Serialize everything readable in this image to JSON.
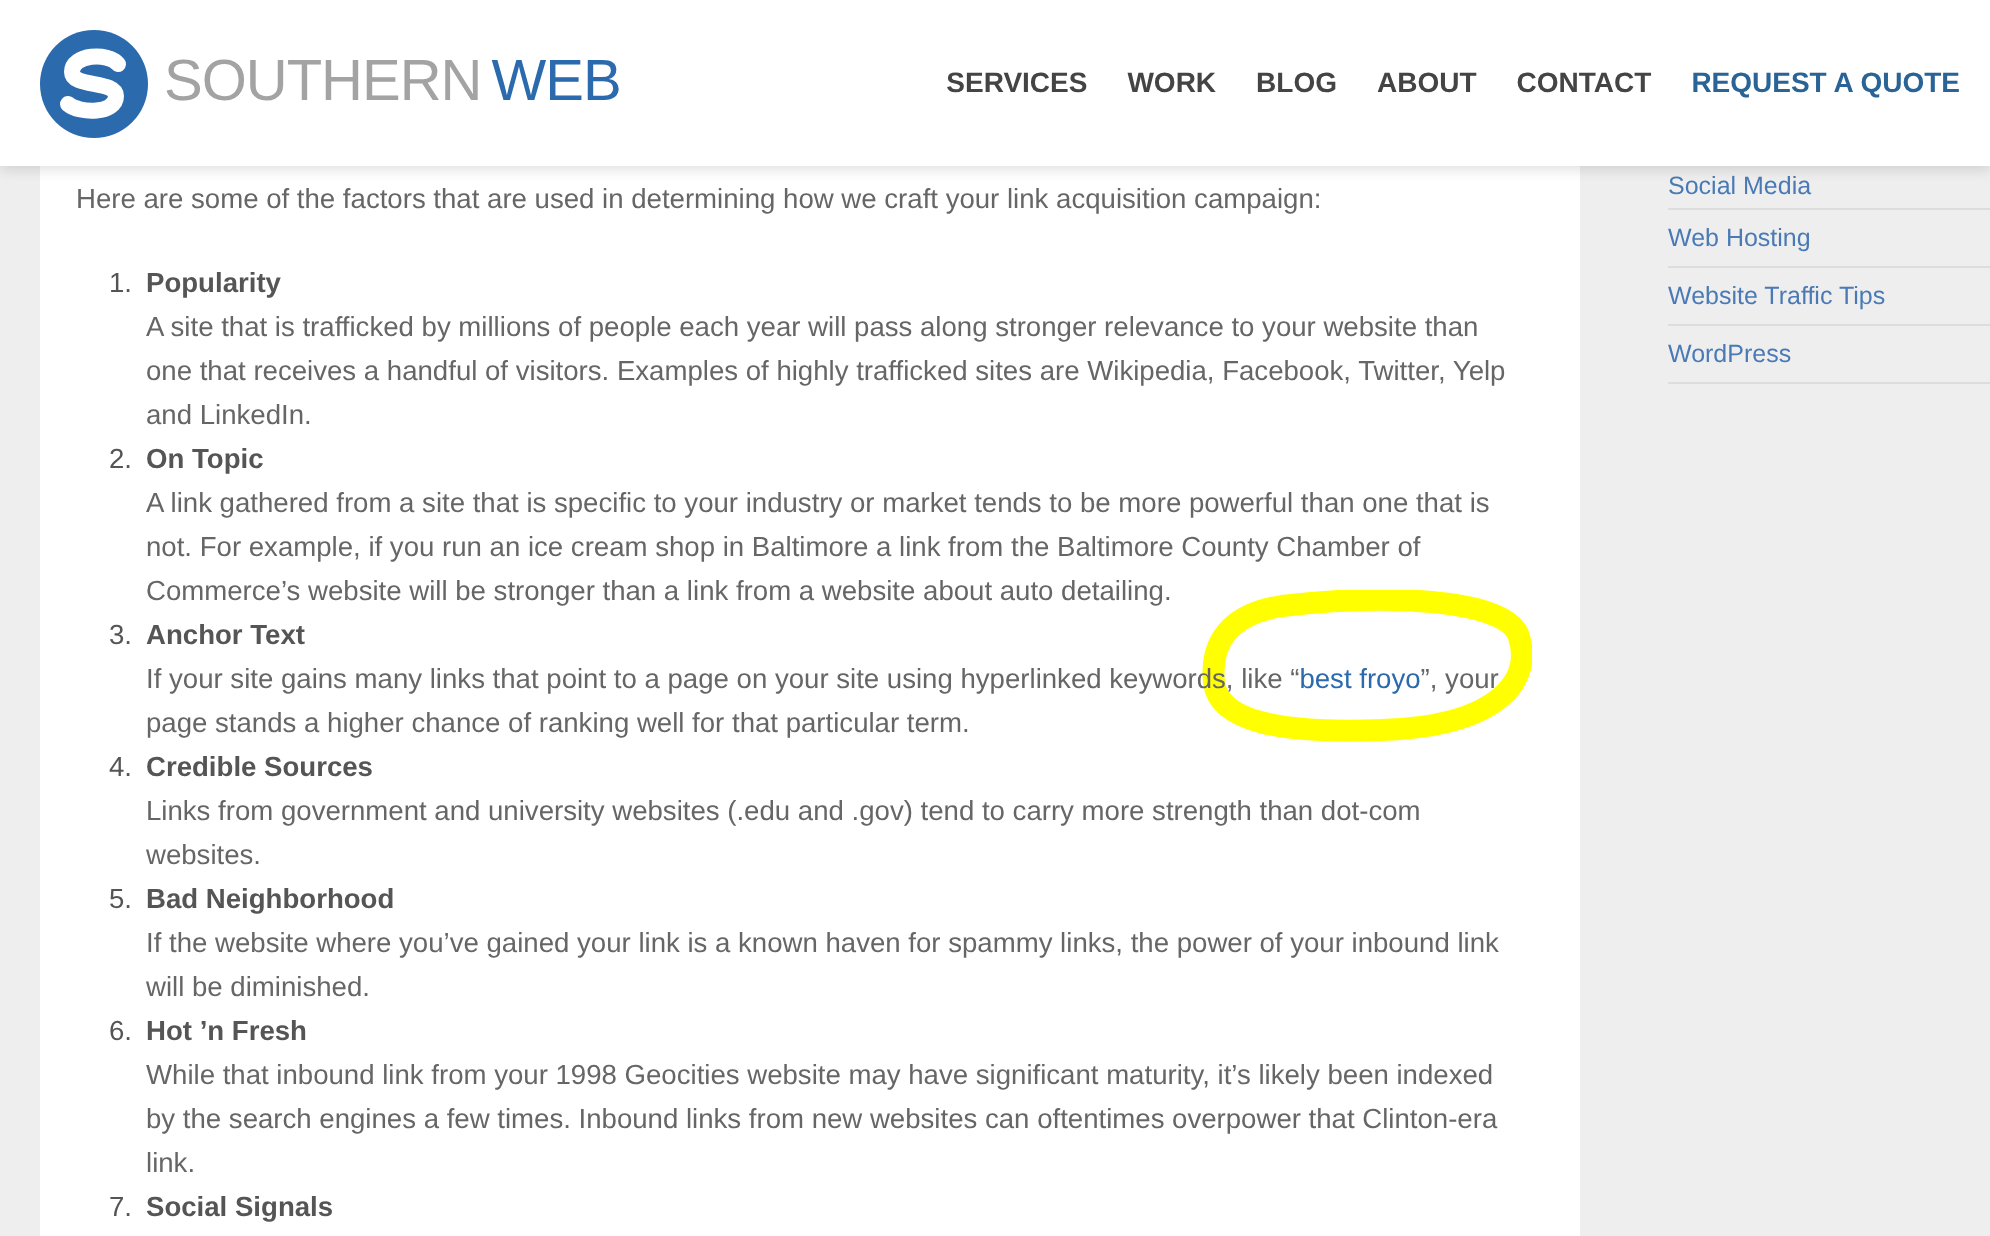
{
  "header": {
    "logo": {
      "word_1": "SOUTHERN",
      "word_2": "WEB"
    },
    "nav": [
      {
        "label": "SERVICES",
        "highlighted": false
      },
      {
        "label": "WORK",
        "highlighted": false
      },
      {
        "label": "BLOG",
        "highlighted": false
      },
      {
        "label": "ABOUT",
        "highlighted": false
      },
      {
        "label": "CONTACT",
        "highlighted": false
      },
      {
        "label": "REQUEST A QUOTE",
        "highlighted": true
      }
    ]
  },
  "intro": "Here are some of the factors that are used in determining how we craft your link acquisition campaign:",
  "factors": [
    {
      "number": "1.",
      "title": "Popularity",
      "description": [
        {
          "kind": "text",
          "text": "A site that is trafficked by millions of people each year will pass along stronger relevance to your website than one that receives a handful of visitors. Examples of highly trafficked sites are Wikipedia, Facebook, Twitter, Yelp and LinkedIn."
        }
      ]
    },
    {
      "number": "2.",
      "title": "On Topic",
      "description": [
        {
          "kind": "text",
          "text": "A link gathered from a site that is specific to your industry or market tends to be more powerful than one that is not. For example, if you run an ice cream shop in Baltimore a link from the Baltimore County Chamber of Commerce’s website will be stronger than a link from a website about auto detailing."
        }
      ]
    },
    {
      "number": "3.",
      "title": "Anchor Text",
      "description": [
        {
          "kind": "text",
          "text": "If your site gains many links that point to a page on your site using hyperlinked keywords, like “"
        },
        {
          "kind": "link",
          "text": "best froyo",
          "circled": true
        },
        {
          "kind": "text",
          "text": "”, your page stands a higher chance of ranking well for that particular term."
        }
      ]
    },
    {
      "number": "4.",
      "title": "Credible Sources",
      "description": [
        {
          "kind": "text",
          "text": "Links from government and university websites (.edu and .gov) tend to carry more strength than dot-com websites."
        }
      ]
    },
    {
      "number": "5.",
      "title": "Bad Neighborhood",
      "description": [
        {
          "kind": "text",
          "text": "If the website where you’ve gained your link is a known haven for spammy links, the power of your inbound link will be diminished."
        }
      ]
    },
    {
      "number": "6.",
      "title": "Hot ’n Fresh",
      "description": [
        {
          "kind": "text",
          "text": "While that inbound link from your 1998 Geocities website may have significant maturity, it’s likely been indexed by the search engines a few times. Inbound links from new websites can oftentimes overpower that Clinton-era link."
        }
      ]
    },
    {
      "number": "7.",
      "title": "Social Signals"
    }
  ],
  "sidebar": {
    "links": [
      "Social Media",
      "Web Hosting",
      "Website Traffic Tips",
      "WordPress"
    ]
  }
}
